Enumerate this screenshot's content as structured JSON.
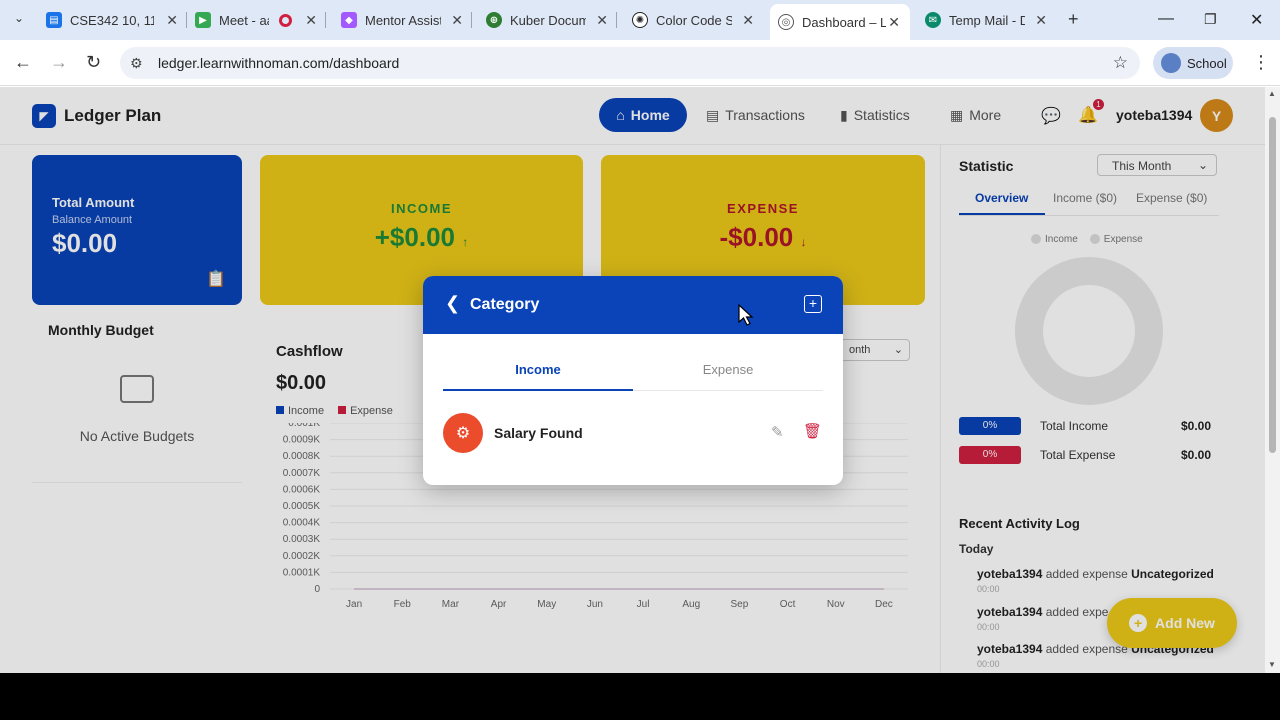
{
  "browser": {
    "tabs": [
      {
        "title": "CSE342 10, 11",
        "color": "#1a73e8"
      },
      {
        "title": "Meet - aa",
        "color": "#34a853"
      },
      {
        "title": "Mentor Assist",
        "color": "#a259ff"
      },
      {
        "title": "Kuber Docum",
        "color": "#2e7d32"
      },
      {
        "title": "Color Code Su",
        "color": "#222222"
      },
      {
        "title": "Dashboard – L",
        "color": "#555555"
      },
      {
        "title": "Temp Mail - D",
        "color": "#0b8a6b"
      }
    ],
    "url": "ledger.learnwithnoman.com/dashboard",
    "profile": "School"
  },
  "nav": {
    "brand": "Ledger Plan",
    "items": [
      "Home",
      "Transactions",
      "Statistics",
      "More"
    ],
    "notif_count": "1",
    "username": "yoteba1394",
    "avatar_initial": "Y"
  },
  "cards": {
    "total_title": "Total Amount",
    "balance_label": "Balance Amount",
    "total_value": "$0.00",
    "income_label": "INCOME",
    "income_value": "+$0.00",
    "expense_label": "EXPENSE",
    "expense_value": "-$0.00"
  },
  "budget": {
    "title": "Monthly Budget",
    "empty_text": "No Active Budgets"
  },
  "cashflow": {
    "title": "Cashflow",
    "amount": "$0.00",
    "legend": [
      "Income",
      "Expense"
    ],
    "period_select": "onth"
  },
  "chart_data": {
    "type": "line",
    "categories": [
      "Jan",
      "Feb",
      "Mar",
      "Apr",
      "May",
      "Jun",
      "Jul",
      "Aug",
      "Sep",
      "Oct",
      "Nov",
      "Dec"
    ],
    "y_ticks": [
      "0.001K",
      "0.0009K",
      "0.0008K",
      "0.0007K",
      "0.0006K",
      "0.0005K",
      "0.0004K",
      "0.0003K",
      "0.0002K",
      "0.0001K",
      "0"
    ],
    "series": [
      {
        "name": "Income",
        "values": [
          0,
          0,
          0,
          0,
          0,
          0,
          0,
          0,
          0,
          0,
          0,
          0
        ],
        "color": "#0a44b8"
      },
      {
        "name": "Expense",
        "values": [
          0,
          0,
          0,
          0,
          0,
          0,
          0,
          0,
          0,
          0,
          0,
          0
        ],
        "color": "#d02040"
      }
    ],
    "ylim": [
      0,
      0.001
    ],
    "grid": true
  },
  "statistic": {
    "title": "Statistic",
    "period": "This Month",
    "tabs": [
      "Overview",
      "Income ($0)",
      "Expense ($0)"
    ],
    "legend": [
      "Income",
      "Expense"
    ],
    "totals": [
      {
        "pct": "0%",
        "label": "Total Income",
        "value": "$0.00",
        "color": "#0a44b8",
        "share": 0
      },
      {
        "pct": "0%",
        "label": "Total Expense",
        "value": "$0.00",
        "color": "#d02040",
        "share": 0
      }
    ]
  },
  "activity": {
    "title": "Recent Activity Log",
    "group": "Today",
    "items": [
      {
        "user": "yoteba1394",
        "action": "added expense",
        "category": "Uncategorized",
        "time": "00:00"
      },
      {
        "user": "yoteba1394",
        "action": "added expe",
        "category": "",
        "time": "00:00"
      },
      {
        "user": "yoteba1394",
        "action": "added expense",
        "category": "Uncategorized",
        "time": "00:00"
      }
    ]
  },
  "add_new_label": "Add New",
  "dialog": {
    "title": "Category",
    "tabs": [
      "Income",
      "Expense"
    ],
    "items": [
      {
        "name": "Salary Found"
      }
    ]
  }
}
